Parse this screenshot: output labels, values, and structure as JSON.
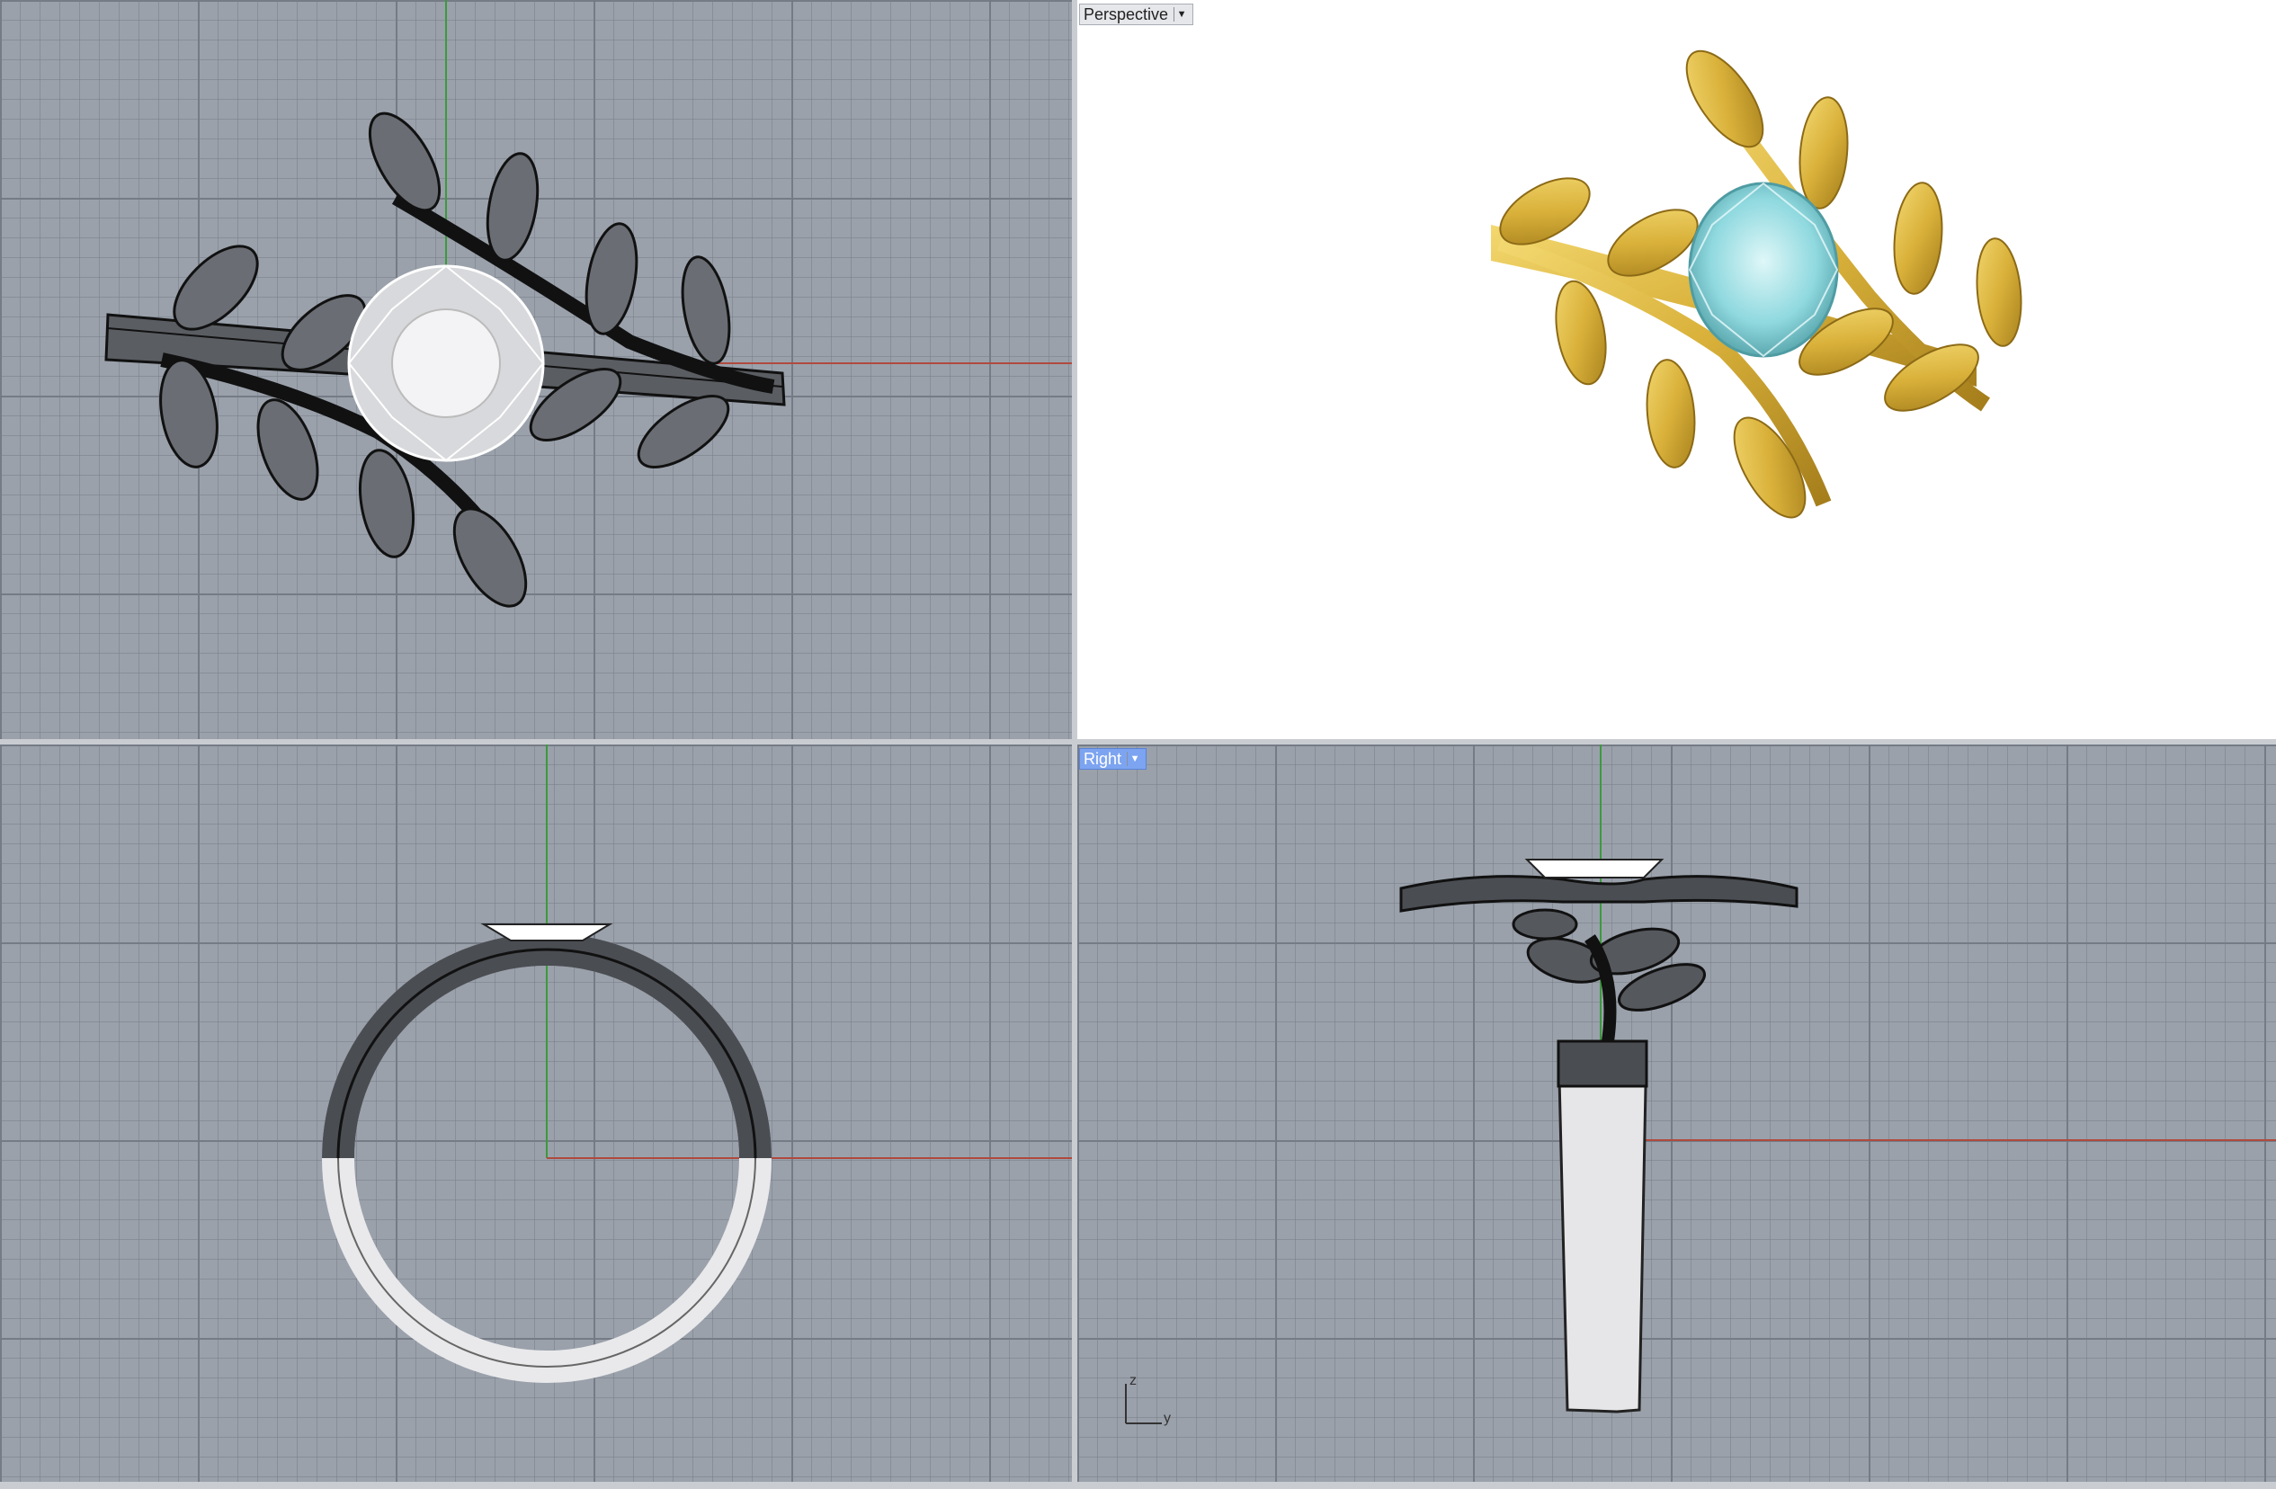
{
  "viewports": {
    "top": {
      "label": ""
    },
    "perspective": {
      "label": "Perspective",
      "menu_icon": "caret-down-icon"
    },
    "front": {
      "label": ""
    },
    "right": {
      "label": "Right",
      "menu_icon": "caret-down-icon",
      "active": true
    }
  },
  "axis_indicator": {
    "z_label": "z",
    "y_label": "y"
  },
  "colors": {
    "viewport_bg": "#9aa1ab",
    "grid_line": "#7e848d",
    "x_axis": "#b04a3e",
    "z_axis": "#3c9a3c",
    "wire": "#1e1e1e",
    "gold": "#d9b13a",
    "gem_blue": "#8fd9df",
    "active_label": "#7da4f0"
  }
}
